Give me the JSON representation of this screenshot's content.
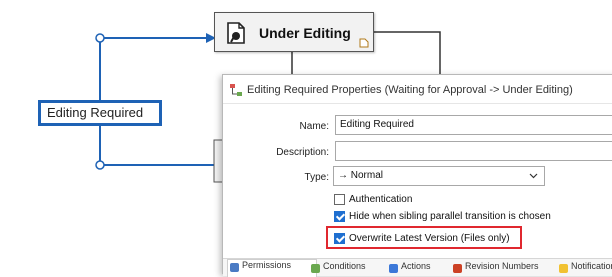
{
  "state": {
    "title": "Under Editing"
  },
  "transition": {
    "label": "Editing Required"
  },
  "dialog": {
    "title": "Editing Required Properties (Waiting for Approval -> Under Editing)",
    "name_label": "Name:",
    "name_value": "Editing Required",
    "description_label": "Description:",
    "description_value": "",
    "type_label": "Type:",
    "type_value": "→ Normal",
    "options": [
      {
        "label": "Authentication",
        "checked": false
      },
      {
        "label": "Hide when sibling parallel transition is chosen",
        "checked": true
      },
      {
        "label": "Overwrite Latest Version (Files only)",
        "checked": true
      }
    ],
    "tabs": [
      {
        "label": "Permissions",
        "color": "#4a7bc4"
      },
      {
        "label": "Conditions",
        "color": "#6aa84f"
      },
      {
        "label": "Actions",
        "color": "#3c78d8"
      },
      {
        "label": "Revision Numbers",
        "color": "#cc4125"
      },
      {
        "label": "Notifications",
        "color": "#f1c232"
      }
    ]
  },
  "colors": {
    "connector_blue": "#1e62b5",
    "highlight_red": "#e0282f",
    "check_blue": "#1f6fd0"
  }
}
